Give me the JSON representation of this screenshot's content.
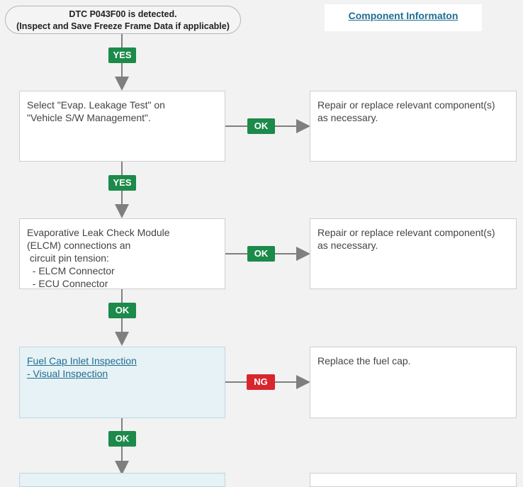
{
  "start": {
    "line1": "DTC P043F00 is detected.",
    "line2": "(Inspect and Save Freeze Frame Data if applicable)"
  },
  "component_info_link": "Component Informaton",
  "steps": [
    {
      "lines": [
        "Select \"Evap. Leakage Test\" on",
        "\"Vehicle S/W Management\"."
      ],
      "side_label": "OK",
      "side_text": [
        "Repair or replace relevant component(s)",
        "as necessary."
      ]
    },
    {
      "lines": [
        "Evaporative Leak Check Module",
        "(ELCM) connections an",
        " circuit pin tension:",
        "  - ELCM Connector",
        "  - ECU Connector"
      ],
      "side_label": "OK",
      "side_text": [
        "Repair or replace relevant component(s)",
        "as necessary."
      ]
    },
    {
      "link_lines": [
        "Fuel Cap Inlet Inspection",
        "- Visual Inspection"
      ],
      "side_label": "NG",
      "side_text": [
        "Replace the fuel cap."
      ]
    }
  ],
  "down_labels": [
    "YES",
    "YES",
    "OK",
    "OK"
  ],
  "colors": {
    "ok_green": "#1c8a4a",
    "ng_red": "#d9252e",
    "link": "#1f6d92",
    "arrow": "#7f7f7f"
  }
}
